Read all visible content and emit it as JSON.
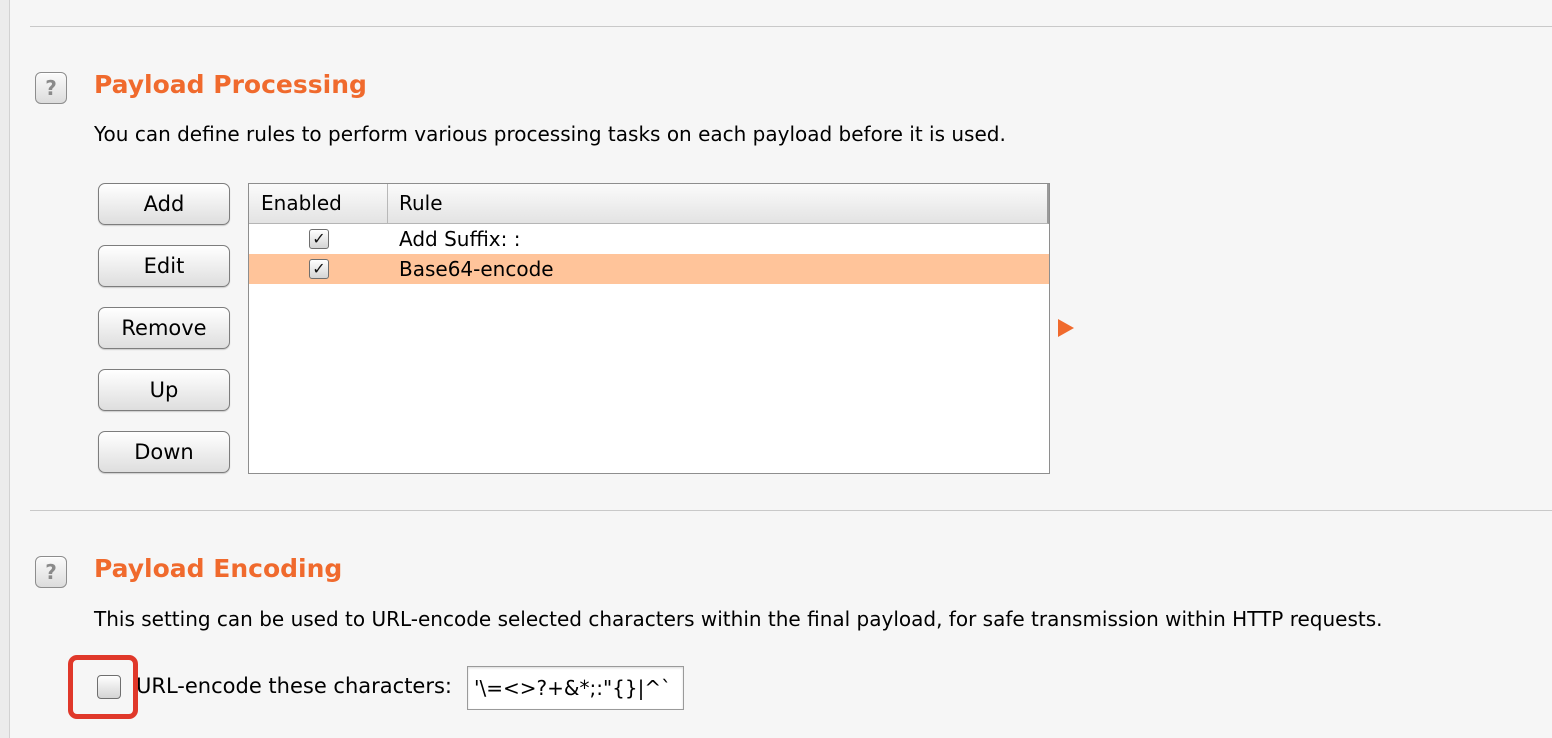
{
  "payload_processing": {
    "help_icon": "?",
    "title": "Payload Processing",
    "description": "You can define rules to perform various processing tasks on each payload before it is used.",
    "buttons": {
      "add": "Add",
      "edit": "Edit",
      "remove": "Remove",
      "up": "Up",
      "down": "Down"
    },
    "table": {
      "columns": [
        "Enabled",
        "Rule"
      ],
      "rows": [
        {
          "enabled": true,
          "enabled_mark": "✓",
          "rule": "Add Suffix: :",
          "selected": false
        },
        {
          "enabled": true,
          "enabled_mark": "✓",
          "rule": "Base64-encode",
          "selected": true
        }
      ]
    },
    "expand_arrow_icon": "triangle-right-icon"
  },
  "payload_encoding": {
    "help_icon": "?",
    "title": "Payload Encoding",
    "description": "This setting can be used to URL-encode selected characters within the final payload, for safe transmission within HTTP requests.",
    "url_encode": {
      "checked": false,
      "label": "URL-encode these characters:",
      "value": "'\\=<>?+&*;:\"{}|^`"
    }
  },
  "colors": {
    "accent": "#f06a2d",
    "selected_row": "#ffc49a",
    "highlight_box": "#e0382a"
  }
}
